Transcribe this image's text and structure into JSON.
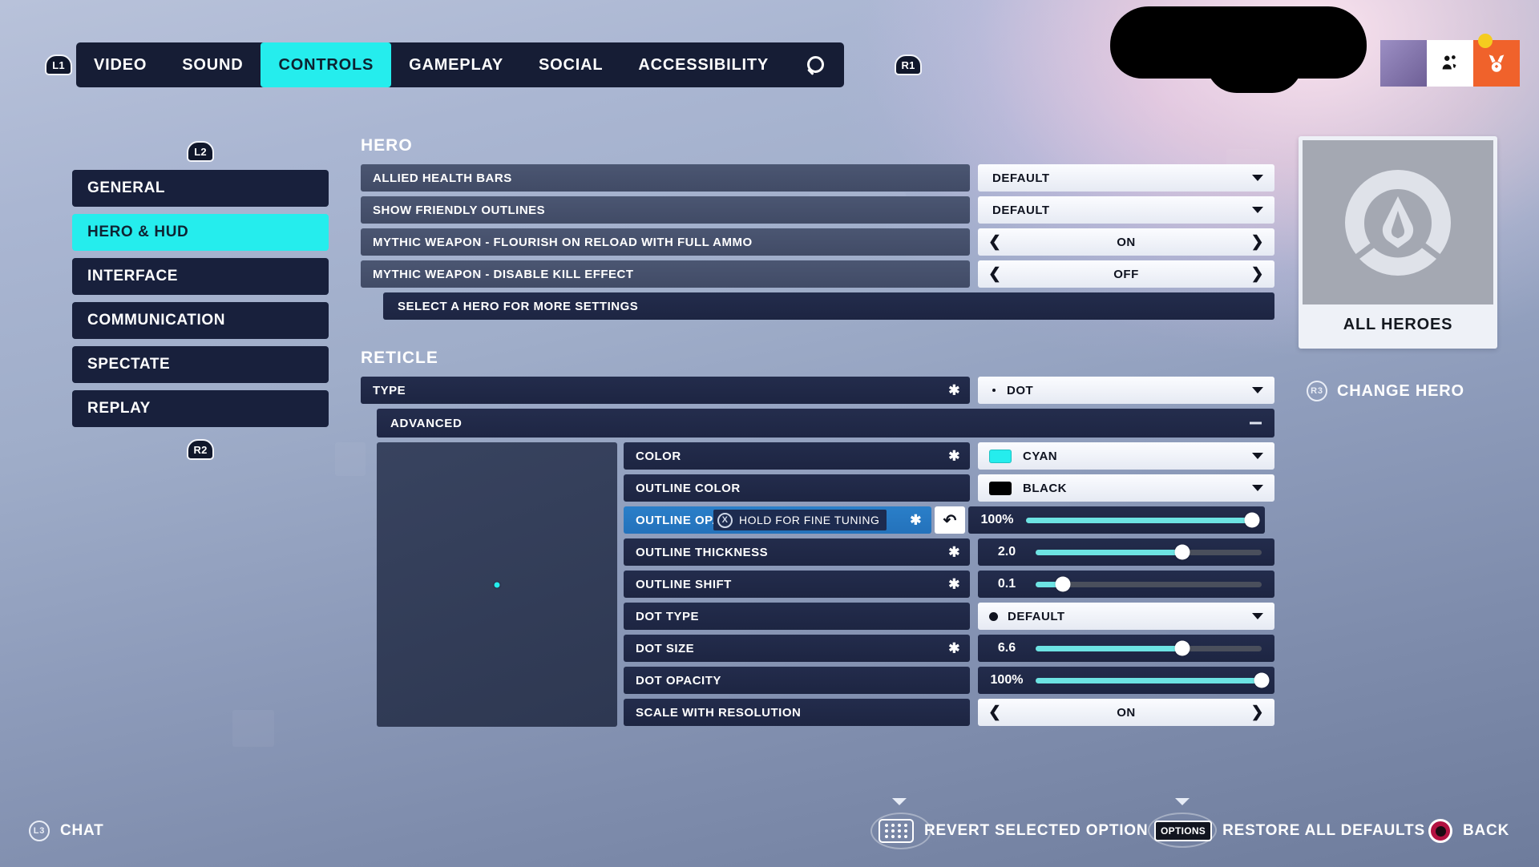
{
  "top_nav": {
    "left_bumper": "L1",
    "right_bumper": "R1",
    "tabs": [
      {
        "label": "VIDEO",
        "active": false
      },
      {
        "label": "SOUND",
        "active": false
      },
      {
        "label": "CONTROLS",
        "active": true
      },
      {
        "label": "GAMEPLAY",
        "active": false
      },
      {
        "label": "SOCIAL",
        "active": false
      },
      {
        "label": "ACCESSIBILITY",
        "active": false
      }
    ],
    "search_icon": "search-icon"
  },
  "top_right": {
    "badge_color": "#f5cc1f",
    "social_icon": "social-group-icon",
    "challenge_icon": "medal-icon"
  },
  "sidebar": {
    "up_bumper": "L2",
    "down_bumper": "R2",
    "items": [
      {
        "label": "GENERAL",
        "active": false
      },
      {
        "label": "HERO & HUD",
        "active": true
      },
      {
        "label": "INTERFACE",
        "active": false
      },
      {
        "label": "COMMUNICATION",
        "active": false
      },
      {
        "label": "SPECTATE",
        "active": false
      },
      {
        "label": "REPLAY",
        "active": false
      }
    ]
  },
  "hero_section": {
    "title": "HERO",
    "rows": [
      {
        "label": "ALLIED HEALTH BARS",
        "type": "dropdown",
        "value": "DEFAULT",
        "star": false
      },
      {
        "label": "SHOW FRIENDLY OUTLINES",
        "type": "dropdown",
        "value": "DEFAULT",
        "star": false
      },
      {
        "label": "MYTHIC WEAPON - FLOURISH ON RELOAD WITH FULL AMMO",
        "type": "stepper",
        "value": "ON",
        "star": false
      },
      {
        "label": "MYTHIC WEAPON - DISABLE KILL EFFECT",
        "type": "stepper",
        "value": "OFF",
        "star": false
      }
    ],
    "select_hero_note": "SELECT A HERO FOR MORE SETTINGS"
  },
  "reticle_section": {
    "title": "RETICLE",
    "type_row": {
      "label": "TYPE",
      "value": "DOT",
      "star": true
    },
    "advanced_label": "ADVANCED",
    "advanced_collapse_icon": "minus-icon",
    "preview_dot_color": "#25eded",
    "rows": [
      {
        "label": "COLOR",
        "type": "dropdown",
        "value": "CYAN",
        "swatch": "#25eded",
        "star": true
      },
      {
        "label": "OUTLINE COLOR",
        "type": "dropdown",
        "value": "BLACK",
        "swatch": "#000000",
        "star": false
      },
      {
        "label": "OUTLINE OPACITY",
        "type": "slider",
        "value": "100%",
        "fill_pct": 100,
        "star": true,
        "selected": true,
        "hint": "HOLD FOR FINE TUNING",
        "hint_button": "X",
        "revert_icon": "undo-icon"
      },
      {
        "label": "OUTLINE THICKNESS",
        "type": "slider",
        "value": "2.0",
        "fill_pct": 65,
        "star": true
      },
      {
        "label": "OUTLINE SHIFT",
        "type": "slider",
        "value": "0.1",
        "fill_pct": 12,
        "star": true
      },
      {
        "label": "DOT TYPE",
        "type": "dropdown",
        "value": "DEFAULT",
        "dot": true,
        "star": false
      },
      {
        "label": "DOT SIZE",
        "type": "slider",
        "value": "6.6",
        "fill_pct": 65,
        "star": true
      },
      {
        "label": "DOT OPACITY",
        "type": "slider",
        "value": "100%",
        "fill_pct": 100,
        "star": false
      },
      {
        "label": "SCALE WITH RESOLUTION",
        "type": "stepper",
        "value": "ON",
        "star": false
      }
    ]
  },
  "hero_card": {
    "logo_icon": "overwatch-logo-icon",
    "name": "ALL HEROES",
    "change_button": "CHANGE HERO",
    "change_stick": "R3"
  },
  "bottom_bar": {
    "chat": {
      "button": "L3",
      "label": "CHAT"
    },
    "revert": {
      "button": "touchpad",
      "label": "REVERT SELECTED OPTION"
    },
    "restore": {
      "button": "OPTIONS",
      "label": "RESTORE ALL DEFAULTS"
    },
    "back": {
      "button": "circle",
      "label": "BACK"
    }
  }
}
